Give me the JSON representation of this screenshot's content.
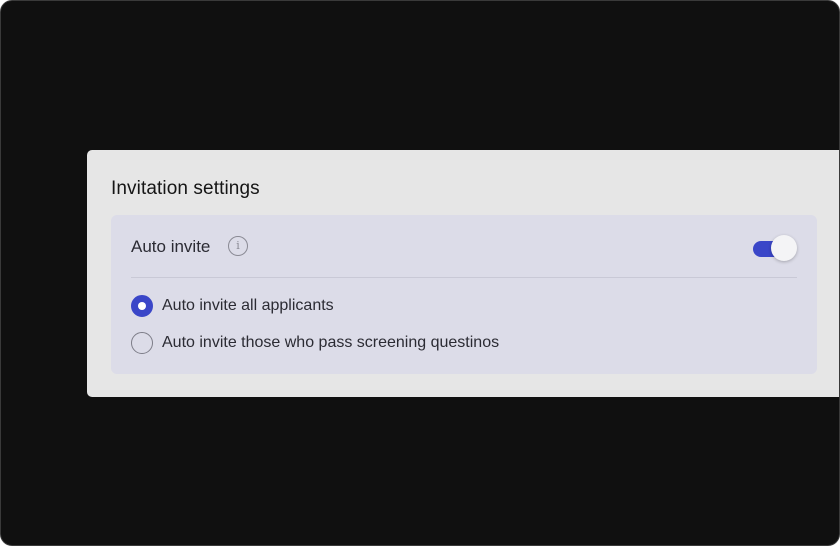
{
  "settings": {
    "title": "Invitation settings",
    "auto_invite": {
      "label": "Auto invite",
      "info_icon": "info-icon",
      "enabled": true
    },
    "options": [
      {
        "label": "Auto invite all applicants",
        "selected": true
      },
      {
        "label": "Auto invite those who pass screening questinos",
        "selected": false
      }
    ]
  },
  "colors": {
    "accent": "#3a46c8",
    "background": "#101010",
    "panel": "#e6e6e6",
    "inner_panel": "#dcdce8"
  }
}
